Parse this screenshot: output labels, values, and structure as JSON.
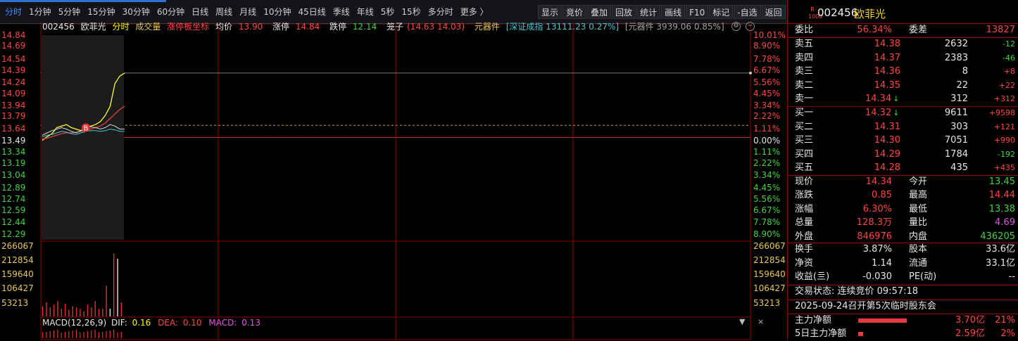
{
  "topbar": {
    "periods": [
      "分时",
      "1分钟",
      "5分钟",
      "15分钟",
      "30分钟",
      "60分钟",
      "日线",
      "周线",
      "月线",
      "10分钟",
      "45日线",
      "季线",
      "年线",
      "5秒",
      "15秒",
      "多分时",
      "更多 〉"
    ],
    "active_period": 0,
    "tools": [
      "显示",
      "竞价",
      "叠加",
      "回放",
      "统计",
      "画线",
      "F10",
      "标记",
      "-自选",
      "返回"
    ]
  },
  "chart_header": {
    "code": "002456",
    "name": "欧菲光",
    "mode": "分时",
    "volume_label": "成交量",
    "limit_label": "涨停板坐标",
    "avg_label": "均价",
    "avg_value": "13.90",
    "limit_up_label": "涨停",
    "limit_up_value": "14.84",
    "limit_down_label": "跌停",
    "limit_down_value": "12.14",
    "cage_label": "笼子",
    "cage_value": "(14.63 14.03)",
    "sector_label": "元器件",
    "index_text": "[深证成指 13111.23 0.27%]",
    "sector_text": "[元器件 3939.06 0.85%]"
  },
  "price_axis_left": [
    "14.84",
    "14.69",
    "14.54",
    "14.39",
    "14.24",
    "14.09",
    "13.94",
    "13.79",
    "13.64",
    "13.49",
    "13.34",
    "13.19",
    "13.04",
    "12.89",
    "12.74",
    "12.59",
    "12.44",
    "12.29"
  ],
  "pct_axis_right": [
    "10.01%",
    "8.90%",
    "7.78%",
    "6.67%",
    "5.56%",
    "4.45%",
    "3.34%",
    "2.22%",
    "1.11%",
    "0.00%",
    "1.11%",
    "2.22%",
    "3.34%",
    "4.45%",
    "5.56%",
    "6.67%",
    "7.78%",
    "8.90%"
  ],
  "volume_axis": [
    "266067",
    "212854",
    "159640",
    "106427",
    "53213"
  ],
  "macd": {
    "label": "MACD(12,26,9)",
    "dif_label": "DIF:",
    "dif": "0.16",
    "dea_label": "DEA:",
    "dea": "0.10",
    "macd_label": "MACD:",
    "macd": "0.13"
  },
  "chart_marker": "B",
  "chart_data": {
    "type": "line",
    "title": "",
    "xlabel": "",
    "ylabel": "",
    "ylim": [
      12.14,
      14.84
    ],
    "base_price": 13.49,
    "series": [
      {
        "name": "",
        "values": [
          13.45,
          13.5,
          13.54,
          13.62,
          13.64,
          13.66,
          13.62,
          13.6,
          13.58,
          13.62,
          13.64,
          13.66,
          13.7,
          13.78,
          13.9,
          14.2,
          14.3,
          14.34
        ]
      },
      {
        "name": "均价",
        "values": [
          13.47,
          13.48,
          13.5,
          13.52,
          13.54,
          13.55,
          13.55,
          13.56,
          13.57,
          13.58,
          13.6,
          13.62,
          13.64,
          13.68,
          13.74,
          13.8,
          13.86,
          13.9
        ]
      }
    ],
    "volume": [
      40000,
      55000,
      35000,
      45000,
      60000,
      30000,
      50000,
      25000,
      40000,
      35000,
      30000,
      20000,
      45000,
      35000,
      60000,
      30000,
      30000,
      120000,
      30000,
      245000,
      225000,
      55000
    ]
  },
  "panel": {
    "code": "002456",
    "name": "欧菲光",
    "r_icon": "R 1000",
    "ratio_label": "委比",
    "ratio_value": "56.34%",
    "diff_label": "委差",
    "diff_value": "13827",
    "asks": [
      {
        "label": "卖五",
        "price": "14.38",
        "vol": "2632",
        "chg": "-12"
      },
      {
        "label": "卖四",
        "price": "14.37",
        "vol": "2383",
        "chg": "-46"
      },
      {
        "label": "卖三",
        "price": "14.36",
        "vol": "8",
        "chg": "+8"
      },
      {
        "label": "卖二",
        "price": "14.35",
        "vol": "22",
        "chg": "+22"
      },
      {
        "label": "卖一",
        "price": "14.34",
        "vol": "312",
        "chg": "+312",
        "arrow": "↓"
      }
    ],
    "bids": [
      {
        "label": "买一",
        "price": "14.32",
        "vol": "9611",
        "chg": "+9598",
        "arrow": "↓"
      },
      {
        "label": "买二",
        "price": "14.31",
        "vol": "303",
        "chg": "+121"
      },
      {
        "label": "买三",
        "price": "14.30",
        "vol": "7051",
        "chg": "+990"
      },
      {
        "label": "买四",
        "price": "14.29",
        "vol": "1784",
        "chg": "-192"
      },
      {
        "label": "买五",
        "price": "14.28",
        "vol": "435",
        "chg": "+435"
      }
    ],
    "stats": [
      {
        "l1": "现价",
        "v1": "14.34",
        "l2": "今开",
        "v2": "13.45"
      },
      {
        "l1": "涨跌",
        "v1": "0.85",
        "l2": "最高",
        "v2": "14.44"
      },
      {
        "l1": "涨幅",
        "v1": "6.30%",
        "l2": "最低",
        "v2": "13.38"
      },
      {
        "l1": "总量",
        "v1": "128.3万",
        "l2": "量比",
        "v2": "4.69"
      },
      {
        "l1": "外盘",
        "v1": "846976",
        "l2": "内盘",
        "v2": "436205"
      }
    ],
    "stats2": [
      {
        "l1": "换手",
        "v1": "3.87%",
        "l2": "股本",
        "v2": "33.6亿"
      },
      {
        "l1": "净资",
        "v1": "1.14",
        "l2": "流通",
        "v2": "33.1亿"
      },
      {
        "l1": "收益(亖)",
        "v1": "-0.030",
        "l2": "PE(动)",
        "v2": "--"
      }
    ],
    "trade_status": "交易状态: 连续竞价 09:57:18",
    "notice": "2025-09-24召开第5次临时股东会",
    "flows": [
      {
        "label": "主力净额",
        "value": "3.70亿",
        "pct": "21%",
        "bar": 0.21
      },
      {
        "label": "5日主力净额",
        "value": "2.59亿",
        "pct": "2%",
        "bar": 0.02
      }
    ],
    "colors": {
      "up": "#ff4545",
      "down": "#3fd43f",
      "neutral": "#e6e6e6"
    }
  }
}
